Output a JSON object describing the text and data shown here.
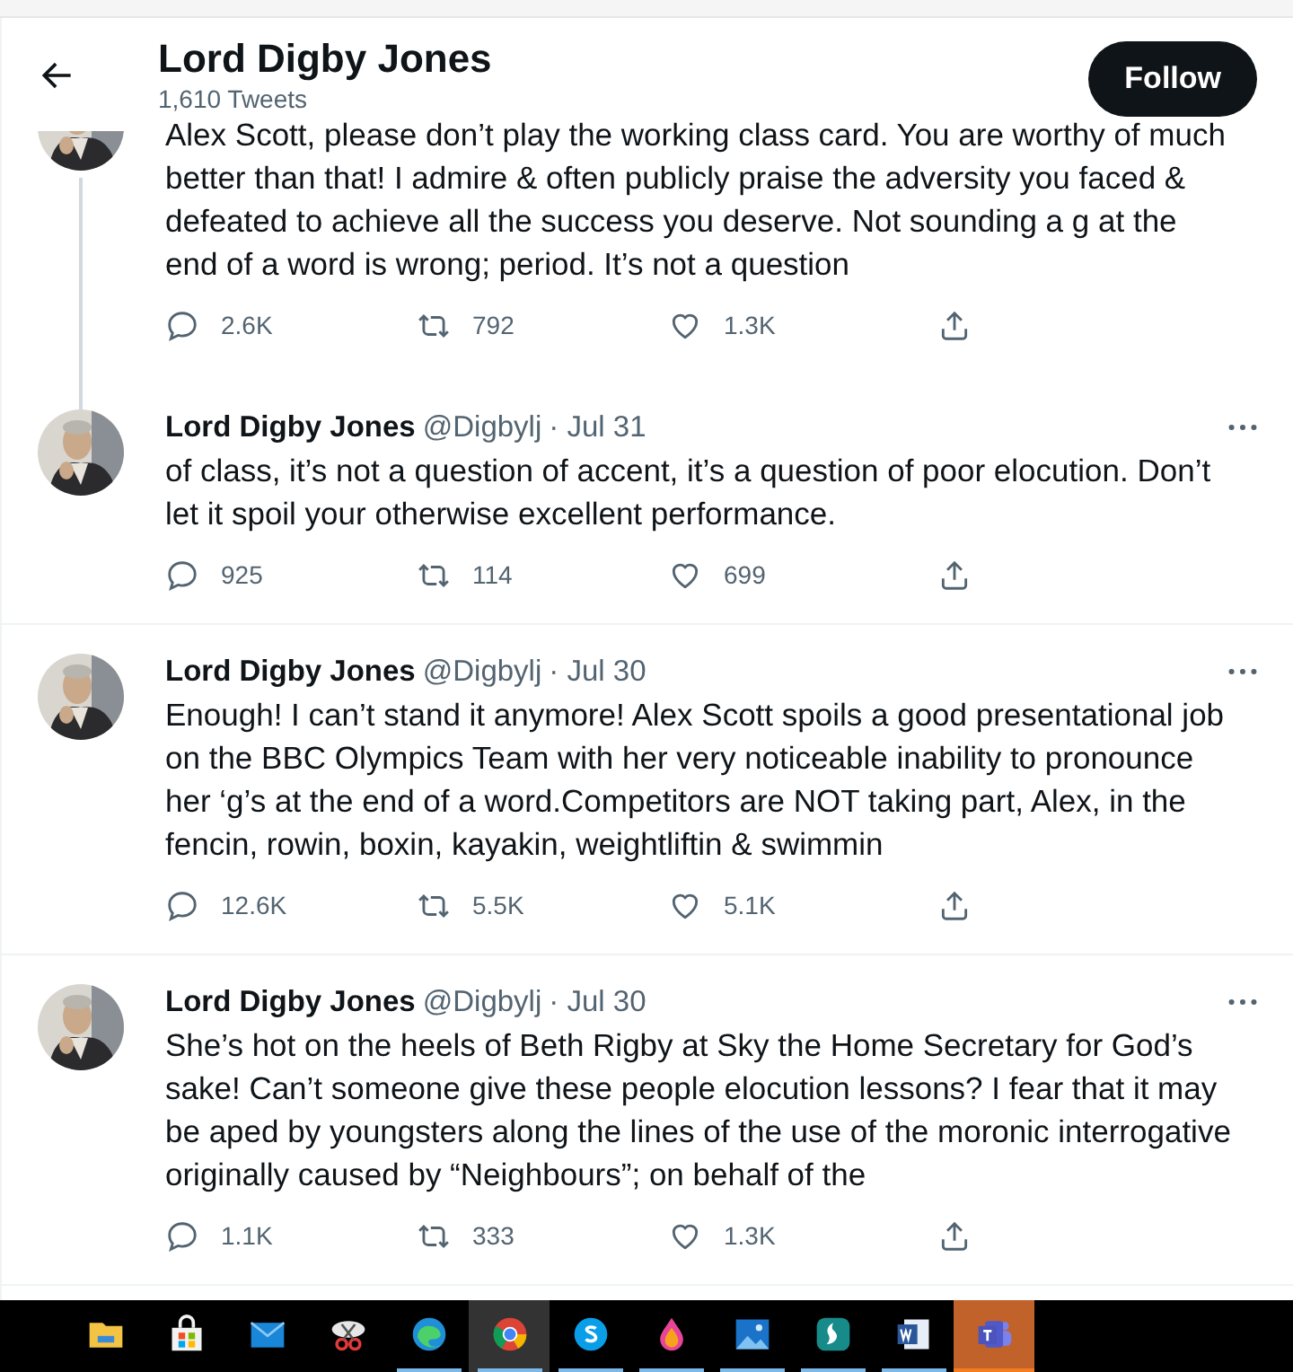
{
  "header": {
    "title": "Lord Digby Jones",
    "subtitle": "1,610 Tweets",
    "follow_button": "Follow"
  },
  "tweets": [
    {
      "kind": "continued",
      "thread_below": true,
      "text": "Alex Scott, please don’t play the working class card. You are worthy of much better than that! I admire & often publicly praise the adversity you faced & defeated to achieve all the success you deserve. Not sounding a g at the end of a word is wrong; period. It’s not a question",
      "replies": "2.6K",
      "retweets": "792",
      "likes": "1.3K"
    },
    {
      "kind": "full",
      "thread_below": false,
      "name": "Lord Digby Jones",
      "handle": "@Digbylj",
      "date": "· Jul 31",
      "text": "of class, it’s not a question of accent, it’s a question of poor elocution. Don’t let it spoil your otherwise excellent performance.",
      "replies": "925",
      "retweets": "114",
      "likes": "699"
    },
    {
      "kind": "full",
      "thread_below": false,
      "name": "Lord Digby Jones",
      "handle": "@Digbylj",
      "date": "· Jul 30",
      "text": "Enough! I can’t stand it anymore! Alex Scott spoils a good presentational job on the BBC Olympics Team with her very noticeable inability to pronounce her ‘g’s at the end of a word.Competitors are NOT taking part, Alex, in the fencin, rowin, boxin, kayakin, weightliftin & swimmin",
      "replies": "12.6K",
      "retweets": "5.5K",
      "likes": "5.1K"
    },
    {
      "kind": "full",
      "thread_below": false,
      "name": "Lord Digby Jones",
      "handle": "@Digbylj",
      "date": "· Jul 30",
      "text": "She’s hot on the heels of Beth Rigby at Sky the Home Secretary for God’s sake! Can’t someone give these people elocution lessons? I fear that it may be aped by youngsters along the lines of the use of the moronic interrogative originally caused by “Neighbours”; on behalf of the",
      "replies": "1.1K",
      "retweets": "333",
      "likes": "1.3K"
    }
  ],
  "taskbar": [
    {
      "kind": "folder",
      "running": false,
      "selected": false
    },
    {
      "kind": "store",
      "running": false,
      "selected": false
    },
    {
      "kind": "mail",
      "running": false,
      "selected": false
    },
    {
      "kind": "snip",
      "running": false,
      "selected": false
    },
    {
      "kind": "edge",
      "running": true,
      "selected": false
    },
    {
      "kind": "chrome",
      "running": true,
      "selected": true
    },
    {
      "kind": "skype",
      "running": true,
      "selected": false
    },
    {
      "kind": "drop",
      "running": true,
      "selected": false
    },
    {
      "kind": "photos",
      "running": true,
      "selected": false
    },
    {
      "kind": "surfshark",
      "running": true,
      "selected": false
    },
    {
      "kind": "word",
      "running": true,
      "selected": false
    },
    {
      "kind": "teams",
      "running": true,
      "selected": false,
      "attention": true
    }
  ]
}
